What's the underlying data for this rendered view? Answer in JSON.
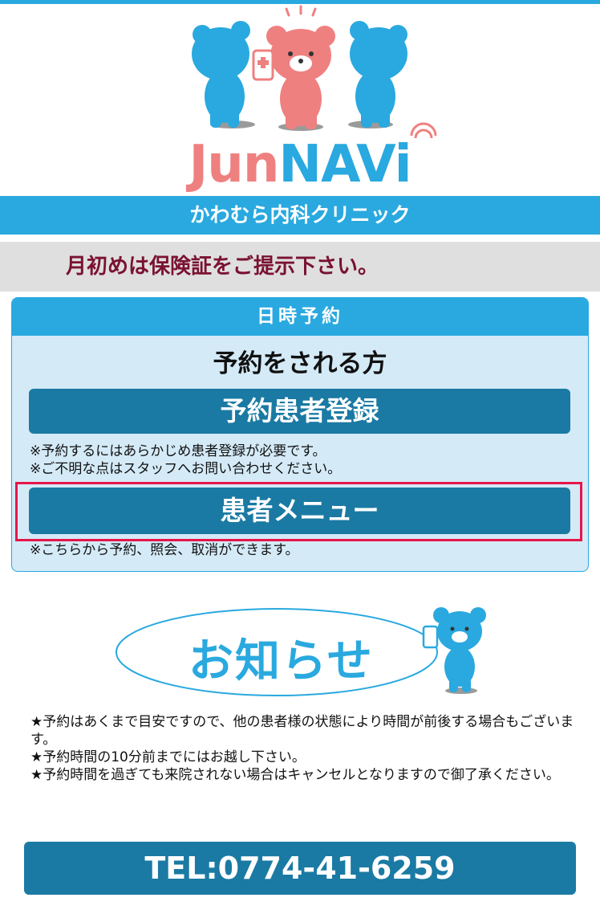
{
  "brand": {
    "logo_text_jun": "Jun",
    "logo_text_navi": "NAVi"
  },
  "clinic": {
    "name": "かわむら内科クリニック"
  },
  "notice": {
    "text": "月初めは保険証をご提示下さい。"
  },
  "reservation": {
    "header": "日時予約",
    "subtitle": "予約をされる方",
    "register_button": "予約患者登録",
    "register_note_1": "※予約するにはあらかじめ患者登録が必要です。",
    "register_note_2": "※ご不明な点はスタッフへお問い合わせください。",
    "menu_button": "患者メニュー",
    "menu_note": "※こちらから予約、照会、取消ができます。"
  },
  "news": {
    "title": "お知らせ",
    "items": [
      "★予約はあくまで目安ですので、他の患者様の状態により時間が前後する場合もございます。",
      "★予約時間の10分前までにはお越し下さい。",
      "★予約時間を過ぎても来院されない場合はキャンセルとなりますので御了承ください。"
    ]
  },
  "contact": {
    "tel": "TEL:0774-41-6259"
  },
  "colors": {
    "accent": "#29a9df",
    "button": "#1a7aa3",
    "highlight": "#e8154a",
    "notice_text": "#7a1232",
    "logo_pink": "#ef8080"
  }
}
